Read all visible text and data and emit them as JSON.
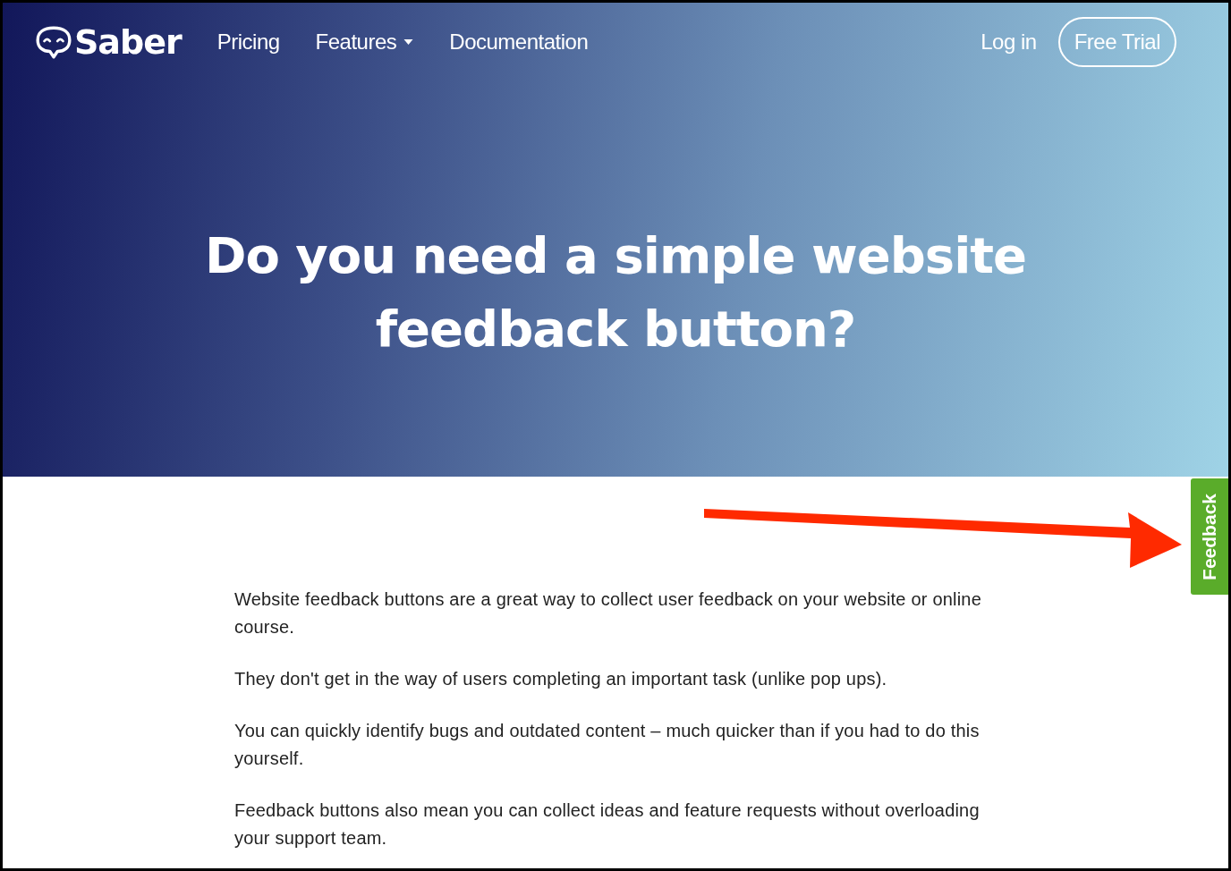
{
  "nav": {
    "logo": "Saber",
    "links": [
      {
        "label": "Pricing",
        "dropdown": false
      },
      {
        "label": "Features",
        "dropdown": true
      },
      {
        "label": "Documentation",
        "dropdown": false
      }
    ],
    "login": "Log in",
    "cta": "Free Trial"
  },
  "hero": {
    "title": "Do you need a simple website feedback button?"
  },
  "feedback_tab": {
    "label": "Feedback"
  },
  "paragraphs": [
    "Website feedback buttons are a great way to collect user feedback on your website or online course.",
    "They don't get in the way of users completing an important task (unlike pop ups).",
    "You can quickly identify bugs and outdated content – much quicker than if you had to do this yourself.",
    "Feedback buttons also mean you can collect ideas and feature requests without overloading your support team."
  ]
}
